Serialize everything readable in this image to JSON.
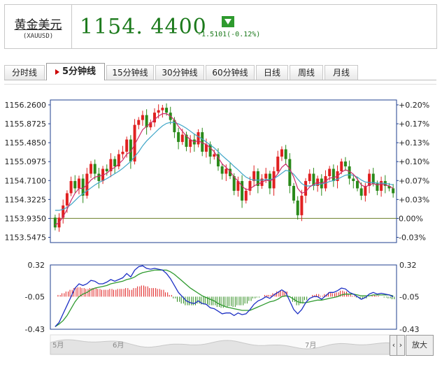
{
  "instrument": {
    "name": "黄金美元",
    "code": "(XAUUSD)"
  },
  "quote": {
    "price": "1154. 4400",
    "change": "-1.5101(-0.12%)",
    "direction": "down",
    "icon": "down-arrow-icon"
  },
  "tabs": [
    {
      "label": "分时线",
      "active": false
    },
    {
      "label": "5分钟线",
      "active": true
    },
    {
      "label": "15分钟线",
      "active": false
    },
    {
      "label": "30分钟线",
      "active": false
    },
    {
      "label": "60分钟线",
      "active": false
    },
    {
      "label": "日线",
      "active": false
    },
    {
      "label": "周线",
      "active": false
    },
    {
      "label": "月线",
      "active": false
    }
  ],
  "navigator": {
    "months": [
      "5月",
      "6月",
      "7月"
    ],
    "zoom_label": "放大"
  },
  "colors": {
    "up": "#e02020",
    "down": "#2a8a1a",
    "ma_short": "#cc2a6a",
    "ma_long": "#3fa6c8",
    "border": "#1f3f8f",
    "base": "#6b7f2a"
  },
  "chart_data": [
    {
      "type": "candlestick",
      "y_ticks": [
        "1156.2600",
        "1155.8725",
        "1155.4850",
        "1155.0975",
        "1154.7100",
        "1154.3225",
        "1153.9350",
        "1153.5475"
      ],
      "y_right_ticks": [
        "+0.20%",
        "+0.17%",
        "+0.13%",
        "+0.10%",
        "+0.07%",
        "+0.03%",
        "0.00%",
        "-0.03%"
      ],
      "ylim": [
        1153.44,
        1156.36
      ],
      "baseline": 1153.935,
      "close": [
        1153.75,
        1153.95,
        1154.2,
        1154.45,
        1154.7,
        1154.55,
        1154.75,
        1154.4,
        1154.85,
        1155.05,
        1154.85,
        1154.7,
        1154.95,
        1154.9,
        1155.15,
        1155.0,
        1155.25,
        1155.3,
        1155.55,
        1155.1,
        1155.85,
        1155.95,
        1156.05,
        1155.8,
        1155.9,
        1156.1,
        1156.15,
        1156.2,
        1156.1,
        1155.95,
        1155.7,
        1155.5,
        1155.65,
        1155.4,
        1155.55,
        1155.45,
        1155.7,
        1155.3,
        1155.45,
        1155.2,
        1155.25,
        1155.0,
        1154.85,
        1154.95,
        1154.8,
        1154.5,
        1154.7,
        1154.3,
        1154.5,
        1154.7,
        1154.9,
        1154.6,
        1154.75,
        1154.85,
        1154.55,
        1154.9,
        1155.2,
        1155.35,
        1155.15,
        1154.6,
        1154.3,
        1154.0,
        1154.4,
        1154.7,
        1154.85,
        1154.6,
        1154.75,
        1154.55,
        1154.8,
        1154.95,
        1154.7,
        1154.9,
        1155.1,
        1155.0,
        1154.75,
        1154.7,
        1154.55,
        1154.4,
        1154.6,
        1154.85,
        1154.65,
        1154.5,
        1154.7,
        1154.6,
        1154.55,
        1154.45
      ],
      "open": [
        1153.95,
        1153.75,
        1153.95,
        1154.2,
        1154.45,
        1154.7,
        1154.55,
        1154.75,
        1154.4,
        1154.85,
        1155.05,
        1154.85,
        1154.7,
        1154.95,
        1154.9,
        1155.15,
        1155.0,
        1155.25,
        1155.3,
        1155.55,
        1155.1,
        1155.85,
        1155.95,
        1156.05,
        1155.8,
        1155.9,
        1156.1,
        1156.15,
        1156.2,
        1156.1,
        1155.95,
        1155.7,
        1155.5,
        1155.65,
        1155.4,
        1155.55,
        1155.45,
        1155.7,
        1155.3,
        1155.45,
        1155.2,
        1155.25,
        1155.0,
        1154.85,
        1154.95,
        1154.8,
        1154.5,
        1154.7,
        1154.3,
        1154.5,
        1154.7,
        1154.9,
        1154.6,
        1154.75,
        1154.85,
        1154.55,
        1154.9,
        1155.2,
        1155.35,
        1155.15,
        1154.6,
        1154.3,
        1154.0,
        1154.4,
        1154.7,
        1154.85,
        1154.6,
        1154.75,
        1154.55,
        1154.8,
        1154.95,
        1154.7,
        1154.9,
        1155.1,
        1155.0,
        1154.75,
        1154.7,
        1154.55,
        1154.4,
        1154.6,
        1154.85,
        1154.65,
        1154.5,
        1154.7,
        1154.6,
        1154.55
      ],
      "ma_short": [
        1153.8,
        1153.85,
        1153.97,
        1154.12,
        1154.3,
        1154.45,
        1154.55,
        1154.55,
        1154.62,
        1154.72,
        1154.78,
        1154.8,
        1154.82,
        1154.86,
        1154.93,
        1154.98,
        1155.05,
        1155.13,
        1155.25,
        1155.3,
        1155.45,
        1155.6,
        1155.75,
        1155.82,
        1155.88,
        1155.96,
        1156.03,
        1156.08,
        1156.08,
        1156.03,
        1155.95,
        1155.82,
        1155.72,
        1155.62,
        1155.55,
        1155.5,
        1155.53,
        1155.48,
        1155.45,
        1155.38,
        1155.3,
        1155.18,
        1155.05,
        1154.98,
        1154.9,
        1154.78,
        1154.7,
        1154.6,
        1154.52,
        1154.54,
        1154.6,
        1154.64,
        1154.67,
        1154.72,
        1154.7,
        1154.75,
        1154.85,
        1154.98,
        1155.05,
        1154.95,
        1154.78,
        1154.55,
        1154.45,
        1154.48,
        1154.58,
        1154.63,
        1154.68,
        1154.65,
        1154.7,
        1154.76,
        1154.77,
        1154.8,
        1154.88,
        1154.93,
        1154.9,
        1154.84,
        1154.74,
        1154.62,
        1154.58,
        1154.62,
        1154.65,
        1154.62,
        1154.64,
        1154.62,
        1154.6,
        1154.55
      ],
      "ma_long": [
        1154.1,
        1154.1,
        1154.12,
        1154.16,
        1154.22,
        1154.3,
        1154.38,
        1154.44,
        1154.5,
        1154.56,
        1154.62,
        1154.67,
        1154.71,
        1154.75,
        1154.8,
        1154.85,
        1154.9,
        1154.96,
        1155.03,
        1155.1,
        1155.2,
        1155.3,
        1155.42,
        1155.52,
        1155.6,
        1155.68,
        1155.76,
        1155.83,
        1155.88,
        1155.9,
        1155.9,
        1155.87,
        1155.83,
        1155.78,
        1155.72,
        1155.66,
        1155.61,
        1155.56,
        1155.5,
        1155.44,
        1155.38,
        1155.3,
        1155.22,
        1155.15,
        1155.08,
        1155.0,
        1154.93,
        1154.85,
        1154.78,
        1154.74,
        1154.72,
        1154.72,
        1154.72,
        1154.73,
        1154.73,
        1154.75,
        1154.8,
        1154.86,
        1154.92,
        1154.9,
        1154.84,
        1154.74,
        1154.65,
        1154.6,
        1154.6,
        1154.61,
        1154.63,
        1154.64,
        1154.66,
        1154.69,
        1154.71,
        1154.74,
        1154.78,
        1154.82,
        1154.83,
        1154.82,
        1154.78,
        1154.72,
        1154.68,
        1154.67,
        1154.67,
        1154.66,
        1154.66,
        1154.65,
        1154.64,
        1154.62
      ]
    },
    {
      "type": "macd",
      "y_ticks": [
        "0.32",
        "-0.05",
        "-0.43"
      ],
      "ylim": [
        -0.43,
        0.32
      ],
      "zero": -0.05,
      "hist": [
        0.0,
        0.02,
        0.04,
        0.06,
        0.08,
        0.1,
        0.11,
        0.1,
        0.09,
        0.1,
        0.1,
        0.09,
        0.08,
        0.08,
        0.09,
        0.08,
        0.09,
        0.09,
        0.1,
        0.08,
        0.1,
        0.12,
        0.13,
        0.12,
        0.1,
        0.1,
        0.09,
        0.08,
        0.05,
        0.02,
        -0.02,
        -0.06,
        -0.08,
        -0.1,
        -0.1,
        -0.1,
        -0.08,
        -0.09,
        -0.09,
        -0.1,
        -0.1,
        -0.12,
        -0.13,
        -0.12,
        -0.11,
        -0.12,
        -0.1,
        -0.1,
        -0.08,
        -0.05,
        -0.02,
        -0.01,
        0.0,
        0.02,
        0.02,
        0.04,
        0.06,
        0.07,
        0.06,
        0.0,
        -0.06,
        -0.1,
        -0.08,
        -0.04,
        0.0,
        0.02,
        0.03,
        0.01,
        0.03,
        0.05,
        0.04,
        0.05,
        0.07,
        0.06,
        0.03,
        0.01,
        -0.01,
        -0.03,
        -0.02,
        0.0,
        0.02,
        0.01,
        0.0,
        -0.01,
        -0.02,
        -0.03
      ],
      "dif": [
        -0.4,
        -0.35,
        -0.25,
        -0.15,
        -0.05,
        0.05,
        0.1,
        0.08,
        0.1,
        0.14,
        0.13,
        0.1,
        0.1,
        0.12,
        0.15,
        0.13,
        0.15,
        0.17,
        0.22,
        0.18,
        0.26,
        0.3,
        0.31,
        0.28,
        0.27,
        0.28,
        0.27,
        0.26,
        0.22,
        0.16,
        0.08,
        0.0,
        -0.05,
        -0.1,
        -0.12,
        -0.13,
        -0.1,
        -0.13,
        -0.14,
        -0.18,
        -0.19,
        -0.22,
        -0.25,
        -0.24,
        -0.24,
        -0.27,
        -0.24,
        -0.26,
        -0.25,
        -0.2,
        -0.14,
        -0.1,
        -0.08,
        -0.05,
        -0.07,
        -0.03,
        0.0,
        0.03,
        0.0,
        -0.1,
        -0.2,
        -0.25,
        -0.2,
        -0.12,
        -0.07,
        -0.05,
        -0.05,
        -0.08,
        -0.04,
        0.0,
        0.0,
        0.02,
        0.05,
        0.04,
        0.0,
        -0.02,
        -0.05,
        -0.08,
        -0.06,
        -0.02,
        0.0,
        -0.02,
        -0.01,
        -0.02,
        -0.03,
        -0.05
      ],
      "dea": [
        -0.4,
        -0.37,
        -0.33,
        -0.27,
        -0.19,
        -0.11,
        -0.05,
        -0.02,
        0.0,
        0.03,
        0.05,
        0.06,
        0.07,
        0.08,
        0.1,
        0.11,
        0.12,
        0.13,
        0.15,
        0.16,
        0.18,
        0.21,
        0.23,
        0.24,
        0.25,
        0.26,
        0.26,
        0.26,
        0.26,
        0.24,
        0.21,
        0.17,
        0.13,
        0.09,
        0.05,
        0.02,
        -0.01,
        -0.04,
        -0.06,
        -0.08,
        -0.1,
        -0.13,
        -0.15,
        -0.17,
        -0.18,
        -0.19,
        -0.2,
        -0.21,
        -0.21,
        -0.21,
        -0.19,
        -0.17,
        -0.15,
        -0.13,
        -0.11,
        -0.1,
        -0.08,
        -0.05,
        -0.04,
        -0.05,
        -0.08,
        -0.11,
        -0.12,
        -0.12,
        -0.11,
        -0.1,
        -0.09,
        -0.09,
        -0.08,
        -0.07,
        -0.06,
        -0.05,
        -0.03,
        -0.02,
        -0.02,
        -0.02,
        -0.03,
        -0.04,
        -0.04,
        -0.04,
        -0.03,
        -0.03,
        -0.03,
        -0.03,
        -0.03,
        -0.04
      ]
    }
  ]
}
